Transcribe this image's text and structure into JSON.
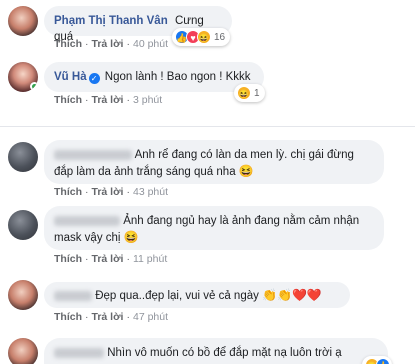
{
  "colors": {
    "link": "#385898",
    "meta": "#65676b",
    "bubble": "#f0f2f5",
    "like": "#1877f2",
    "love": "#f33e58",
    "haha": "#f7b125"
  },
  "actions": {
    "like": "Thích",
    "reply": "Trả lời",
    "dot": "·"
  },
  "comments": [
    {
      "name": "Phạm Thị Thanh Vân",
      "text": "Cưng quá",
      "time": "40 phút",
      "reaction_count": "16"
    },
    {
      "name": "Vũ Hà",
      "verified": true,
      "text": "Ngon lành ! Bao ngon ! Kkkk",
      "time": "3 phút",
      "reaction_count": "1"
    },
    {
      "text": "Anh rể đang có làn da men lỳ. chị gái đừng đắp làm da ảnh trắng sáng quá nha",
      "emoji": "😆",
      "time": "43 phút"
    },
    {
      "text": "Ảnh đang ngủ hay là ảnh đang nằm cảm nhận mask vậy chị",
      "emoji": "😆",
      "time": "11 phút"
    },
    {
      "text": "Đẹp qua..đẹp lại, vui vẻ cả ngày",
      "emoji": "👏👏❤️❤️",
      "time": "47 phút"
    },
    {
      "text": "Nhìn vô muốn có bồ để đắp mặt nạ luôn trời ạ"
    }
  ]
}
